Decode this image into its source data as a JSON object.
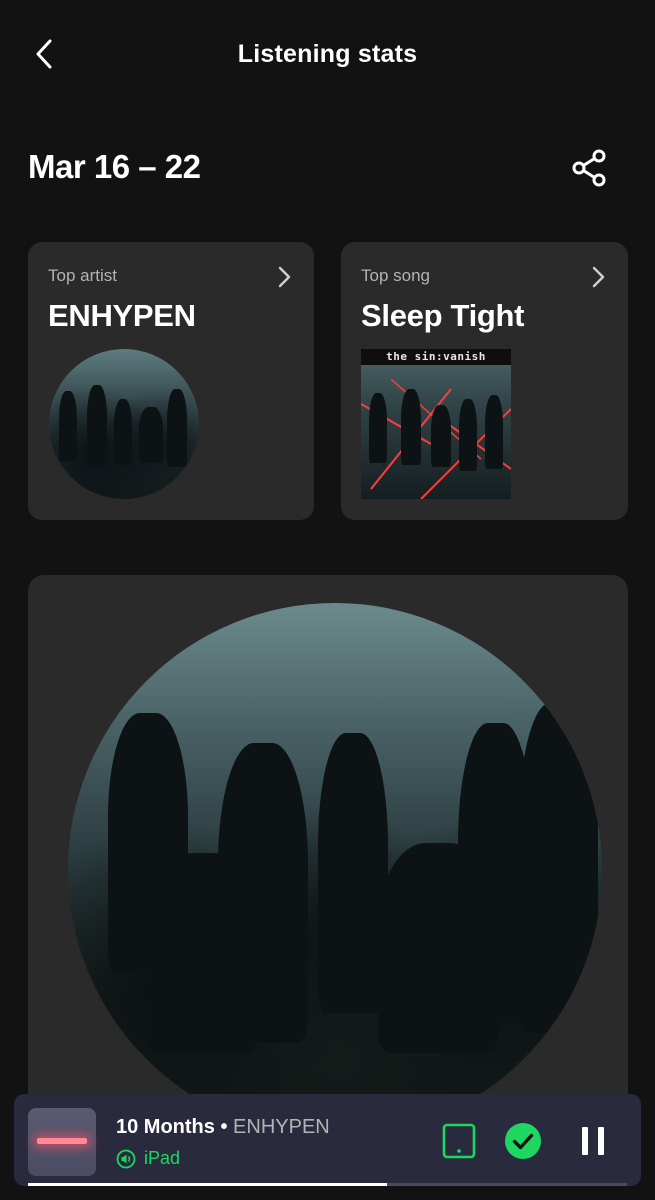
{
  "header": {
    "title": "Listening stats"
  },
  "period": {
    "date_range": "Mar 16 – 22"
  },
  "top_artist": {
    "label": "Top artist",
    "name": "ENHYPEN"
  },
  "top_song": {
    "label": "Top song",
    "title": "Sleep Tight",
    "album_banner": "the sin:vanish"
  },
  "now_playing": {
    "track": "10 Months",
    "separator": " • ",
    "artist": "ENHYPEN",
    "device": "iPad",
    "progress": 0.6
  },
  "colors": {
    "accent": "#1ed760",
    "background": "#121212",
    "card": "#2a2a2a",
    "player": "#2a2a3e"
  },
  "icons": {
    "back": "chevron-left-icon",
    "share": "share-icon",
    "card_chevron": "chevron-right-icon",
    "device": "tablet-icon",
    "saved": "check-circle-icon",
    "pause": "pause-icon",
    "speaker": "speaker-icon"
  }
}
